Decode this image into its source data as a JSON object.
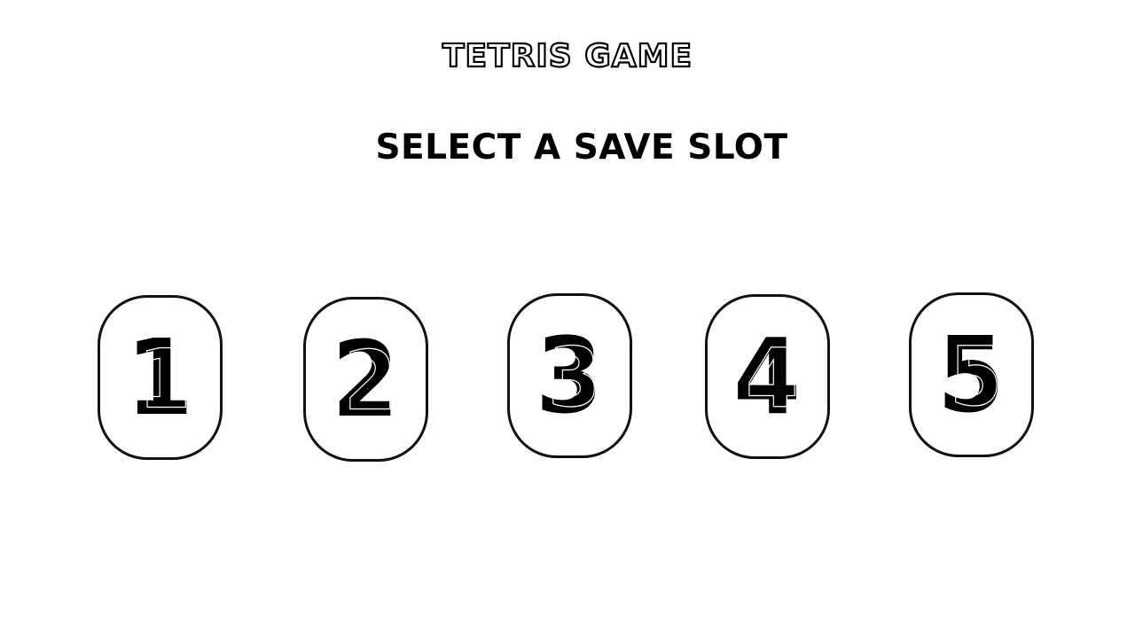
{
  "title": "TETRIS GAME",
  "heading": "SELECT A SAVE SLOT",
  "slots": [
    {
      "label": "1"
    },
    {
      "label": "2"
    },
    {
      "label": "3"
    },
    {
      "label": "4"
    },
    {
      "label": "5"
    }
  ],
  "colors": {
    "background": "#ffffff",
    "foreground": "#000000"
  }
}
